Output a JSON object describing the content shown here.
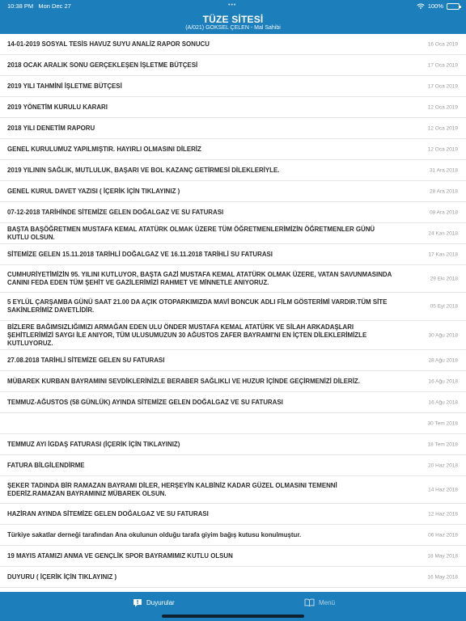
{
  "status": {
    "time": "10:38 PM",
    "date": "Mon Dec 27",
    "battery": "100%",
    "dots": "•••"
  },
  "header": {
    "title": "TÜZE SİTESİ",
    "subtitle": "(A/021) GÖKSEL ÇELEN - Mal Sahibi"
  },
  "announcements": [
    {
      "title": "14-01-2019 SOSYAL TESİS HAVUZ SUYU ANALİZ RAPOR SONUCU",
      "date": "16 Oca 2019"
    },
    {
      "title": "2018 OCAK  ARALIK SONU GERÇEKLEŞEN İŞLETME BÜTÇESİ",
      "date": "17 Oca 2019"
    },
    {
      "title": "2019 YILI TAHMİNİ İŞLETME BÜTÇESİ",
      "date": "17 Oca 2019"
    },
    {
      "title": "2019 YÖNETİM KURULU KARARI",
      "date": "12 Oca 2019"
    },
    {
      "title": "2018 YILI DENETİM RAPORU",
      "date": "12 Oca 2019"
    },
    {
      "title": "GENEL KURULUMUZ YAPILMIŞTIR. HAYIRLI OLMASINI DİLERİZ",
      "date": "12 Oca 2019"
    },
    {
      "title": "2019 YILININ SAĞLIK, MUTLULUK, BAŞARI VE BOL KAZANÇ GETİRMESİ DİLEKLERİYLE.",
      "date": "31 Ara 2018"
    },
    {
      "title": "GENEL KURUL DAVET YAZISI ( İÇERİK İÇİN TIKLAYINIZ )",
      "date": "28 Ara 2018"
    },
    {
      "title": "07-12-2018 TARİHİNDE SİTEMİZE GELEN DOĞALGAZ VE SU FATURASI",
      "date": "08 Ara 2018"
    },
    {
      "title": "BAŞTA BAŞÖĞRETMEN MUSTAFA KEMAL ATATÜRK OLMAK ÜZERE TÜM ÖĞRETMENLERİMİZİN ÖĞRETMENLER GÜNÜ KUTLU OLSUN.",
      "date": "24 Kas 2018"
    },
    {
      "title": "SİTEMİZE GELEN 15.11.2018 TARİHLİ DOĞALGAZ VE 16.11.2018 TARİHLİ SU FATURASI",
      "date": "17 Kas 2018"
    },
    {
      "title": "CUMHURİYETİMİZİN 95. YILINI KUTLUYOR, BAŞTA GAZİ MUSTAFA KEMAL ATATÜRK OLMAK ÜZERE, VATAN SAVUNMASINDA CANINI FEDA EDEN TÜM ŞEHİT VE GAZİLERİMİZİ RAHMET VE MİNNETLE ANIYORUZ.",
      "date": "29 Eki 2018"
    },
    {
      "title": "5 EYLÜL ÇARŞAMBA GÜNÜ SAAT 21.00 DA AÇIK OTOPARKIMIZDA MAVİ BONCUK ADLI FİLM GÖSTERİMİ VARDIR.TÜM SİTE SAKİNLERİMİZ DAVETLİDİR.",
      "date": "05 Eyl 2018"
    },
    {
      "title": " BİZLERE BAĞIMSIZLIĞIMIZI ARMAĞAN EDEN ULU ÖNDER MUSTAFA KEMAL ATATÜRK VE SİLAH ARKADAŞLARI ŞEHİTLERİMİZİ SAYGI İLE ANIYOR, TÜM ULUSUMUZUN 30 AĞUSTOS ZAFER BAYRAMI'NI EN İÇTEN DİLEKLERİMİZLE KUTLUYORUZ.",
      "date": "30 Ağu 2018"
    },
    {
      "title": "27.08.2018 TARİHLİ SİTEMİZE GELEN SU FATURASI",
      "date": "28 Ağu 2018"
    },
    {
      "title": "MÜBAREK KURBAN BAYRAMINI SEVDİKLERİNİZLE BERABER SAĞLIKLI VE HUZUR İÇİNDE GEÇİRMENİZİ DİLERİZ.",
      "date": "16 Ağu 2018"
    },
    {
      "title": "TEMMUZ-AĞUSTOS (58 GÜNLÜK) AYINDA SİTEMİZE GELEN DOĞALGAZ VE SU FATURASI",
      "date": "16 Ağu 2018"
    },
    {
      "title": "",
      "date": "30 Tem 2018"
    },
    {
      "title": "TEMMUZ AYI İGDAŞ FATURASI (İÇERİK İÇİN TIKLAYINIZ)",
      "date": "18 Tem 2018"
    },
    {
      "title": "FATURA BİLGİLENDİRME",
      "date": "20 Haz 2018"
    },
    {
      "title": "ŞEKER TADINDA BİR RAMAZAN BAYRAMI DİLER, HERŞEYİN KALBİNİZ KADAR GÜZEL OLMASINI TEMENNİ EDERİZ.RAMAZAN BAYRAMINIZ MÜBAREK OLSUN.",
      "date": "14 Haz 2018"
    },
    {
      "title": "HAZİRAN AYINDA SİTEMİZE GELEN DOĞALGAZ VE SU FATURASI",
      "date": "12 Haz 2018"
    },
    {
      "title": "Türkiye sakatlar derneği tarafından Ana okulunun olduğu tarafa giyim bağış kutusu konulmuştur.",
      "date": "06 Haz 2018"
    },
    {
      "title": "19 MAYIS ATAMIZI ANMA VE GENÇLİK SPOR BAYRAMIMIZ KUTLU OLSUN",
      "date": "18 May 2018"
    },
    {
      "title": "DUYURU ( İÇERİK İÇİN TIKLAYINIZ )",
      "date": "16 May 2018"
    }
  ],
  "tabbar": {
    "tabs": [
      {
        "label": "Duyurular",
        "icon": "megaphone-icon",
        "active": true
      },
      {
        "label": "Menü",
        "icon": "book-icon",
        "active": false
      }
    ]
  },
  "colors": {
    "primary": "#1c7fbb",
    "date": "#9a9a9a",
    "title": "#2b2b2b"
  }
}
